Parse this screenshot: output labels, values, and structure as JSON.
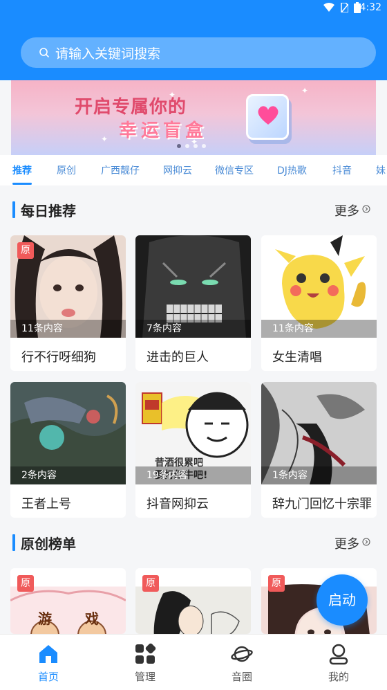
{
  "status_bar": {
    "time": "4:32"
  },
  "search": {
    "placeholder": "请输入关键词搜索"
  },
  "banner": {
    "line1": "开启专属你的",
    "line2": "幸运盲盒"
  },
  "tabs": [
    "推荐",
    "原创",
    "广西靓仔",
    "网抑云",
    "微信专区",
    "DJ热歌",
    "抖音",
    "妹"
  ],
  "sections": {
    "daily": {
      "title": "每日推荐",
      "more": "更多"
    },
    "original": {
      "title": "原创榜单",
      "more": "更多"
    }
  },
  "daily_cards": [
    {
      "name": "行不行呀细狗",
      "count": "11条内容",
      "badge": "原"
    },
    {
      "name": "进击的巨人",
      "count": "7条内容"
    },
    {
      "name": "女生清唱",
      "count": "11条内容"
    },
    {
      "name": "王者上号",
      "count": "2条内容"
    },
    {
      "name": "抖音网抑云",
      "count": "19条内容"
    },
    {
      "name": "辞九门回忆十宗罪",
      "count": "1条内容"
    }
  ],
  "original_cards": [
    {
      "badge": "原",
      "art_text": [
        "游",
        "戏"
      ]
    },
    {
      "badge": "原"
    },
    {
      "badge": "原"
    }
  ],
  "fab": {
    "label": "启动"
  },
  "meme_text": [
    "昔酒很累吧",
    "要打红牛吧!"
  ],
  "bottom_nav": [
    {
      "label": "首页",
      "icon": "home-icon",
      "active": true
    },
    {
      "label": "管理",
      "icon": "grid-icon"
    },
    {
      "label": "音圈",
      "icon": "planet-icon"
    },
    {
      "label": "我的",
      "icon": "user-icon"
    }
  ],
  "colors": {
    "accent": "#1a8cff",
    "badge": "#f05a5a"
  }
}
